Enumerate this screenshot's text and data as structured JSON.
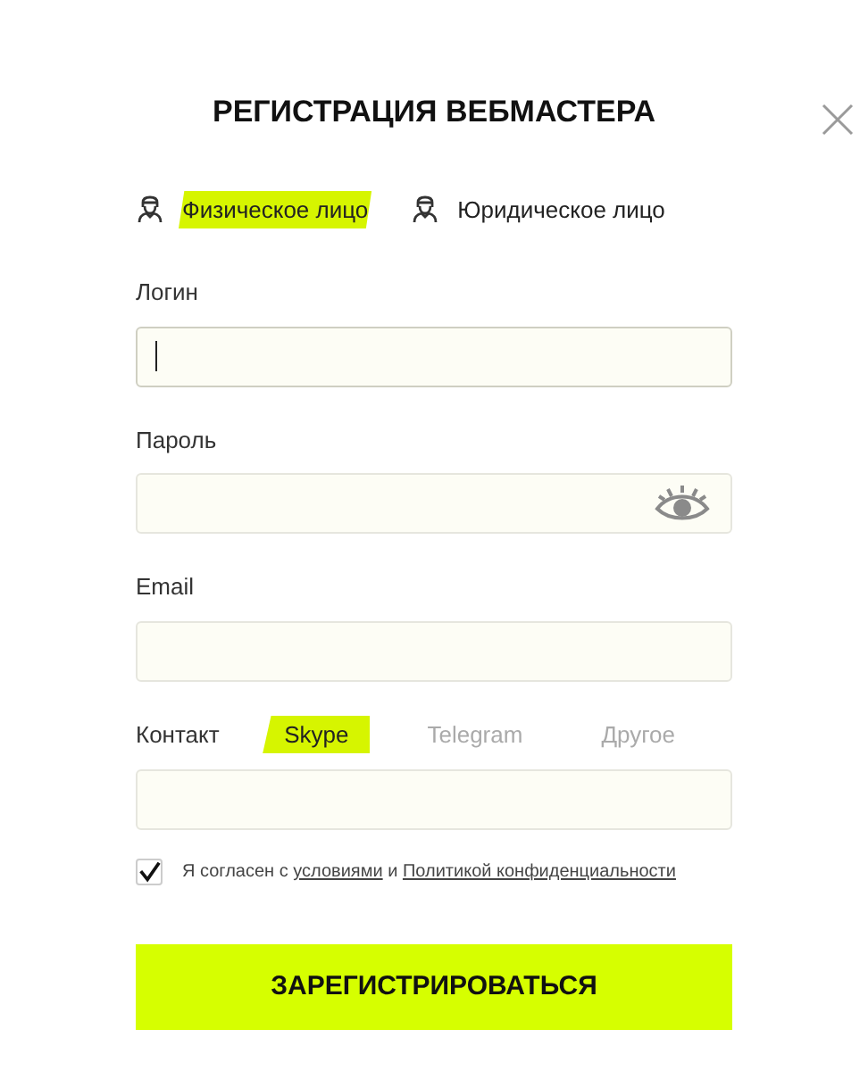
{
  "title": "РЕГИСТРАЦИЯ ВЕБМАСТЕРА",
  "person_types": [
    {
      "label": "Физическое лицо",
      "selected": true
    },
    {
      "label": "Юридическое лицо",
      "selected": false
    }
  ],
  "fields": [
    {
      "label": "Логин",
      "focused": true,
      "kind": "text"
    },
    {
      "label": "Пароль",
      "focused": false,
      "kind": "password"
    },
    {
      "label": "Email",
      "focused": false,
      "kind": "text"
    }
  ],
  "contact": {
    "label": "Контакт",
    "options": [
      {
        "label": "Skype",
        "selected": true
      },
      {
        "label": "Telegram",
        "selected": false
      },
      {
        "label": "Другое",
        "selected": false
      }
    ]
  },
  "consent": {
    "checked": true,
    "text_before": "Я согласен с",
    "terms_link": "условиями",
    "middle": "и",
    "privacy_link": "Политикой конфиденциальности"
  },
  "submit": "ЗАРЕГИСТРИРОВАТЬСЯ"
}
